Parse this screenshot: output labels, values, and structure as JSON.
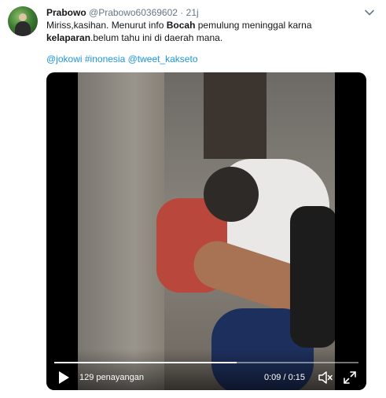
{
  "tweet": {
    "author_name": "Prabowo",
    "author_handle": "@Prabowo60369602",
    "separator": "·",
    "time": "21j",
    "text_line1_part1": "Miriss,kasihan. Menurut info ",
    "text_line1_bold": "Bocah",
    "text_line1_part2": " pemulung meninggal karna",
    "text_line2_bold": "kelaparan",
    "text_line2_part2": ".belum tahu ini di daerah mana.",
    "mentions": [
      "@jokowi",
      "#inonesia",
      "@tweet_kakseto"
    ]
  },
  "video": {
    "views_label": "129 penayangan",
    "timer": "0:09 / 0:15",
    "progress_fraction": 0.6
  }
}
